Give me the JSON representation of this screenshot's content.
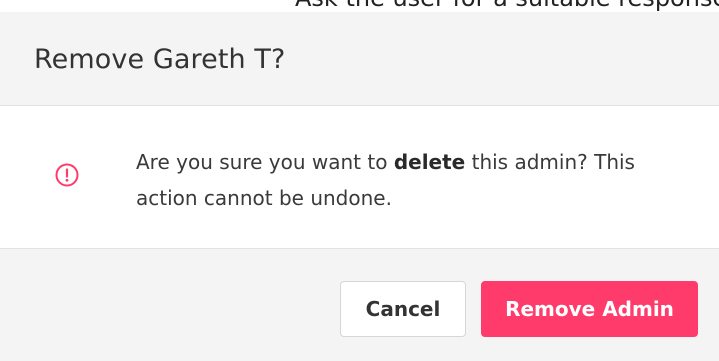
{
  "top_strip_text": "Ask the user for a suitable response prompt to be executed by Hikaroun",
  "dialog": {
    "title": "Remove Gareth T?",
    "icon": "exclamation-circle-icon",
    "message": {
      "before": "Are you sure you want to ",
      "bold": "delete",
      "after": " this admin? This action cannot be undone."
    },
    "buttons": {
      "cancel_label": "Cancel",
      "confirm_label": "Remove Admin"
    }
  },
  "colors": {
    "accent": "#ff3b6b",
    "header_bg": "#f4f4f4",
    "footer_bg": "#f4f4f4",
    "border": "#e2e2e2"
  }
}
